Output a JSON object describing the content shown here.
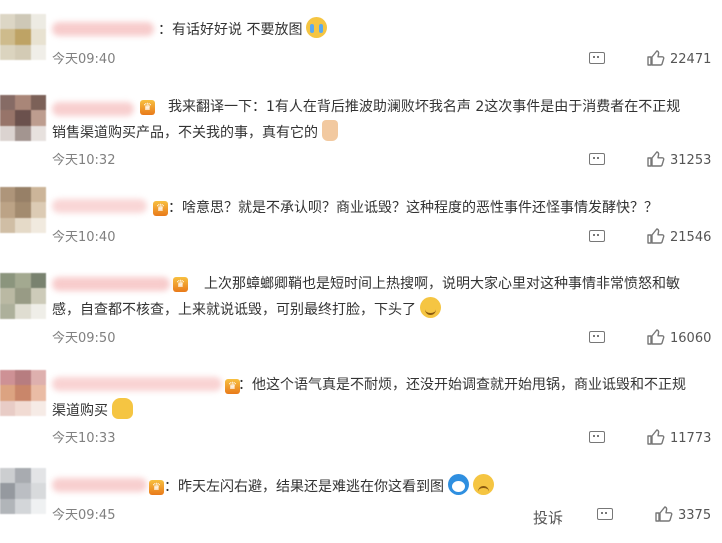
{
  "comments": [
    {
      "text": "：有话好好说 不要放图",
      "emoji": "cry-emoji",
      "time": "今天09:40",
      "likes": "22471",
      "avatar_colors": [
        "#d9d2bf",
        "#c9c3b0",
        "#ece9e0",
        "#c9b480",
        "#b89a55",
        "#e6dfcd",
        "#d8d0b9",
        "#cfc6ae",
        "#efede6"
      ]
    },
    {
      "text": "我来翻译一下：1有人在背后推波助澜败坏我名声 2这次事件是由于消费者在不正规销售渠道购买产品，不关我的事，真有它的",
      "emoji": "thumbs-up-emoji",
      "time": "今天10:32",
      "likes": "31253",
      "avatar_colors": [
        "#7a5c55",
        "#a07a6a",
        "#6e5046",
        "#8c6659",
        "#5c3f3a",
        "#b69383",
        "#d8cfcb",
        "#9a8a85",
        "#e5dedb"
      ]
    },
    {
      "text": "：啥意思？就是不承认呗？商业诋毁？这种程度的恶性事件还怪事情发酵快？？",
      "emoji": "",
      "time": "今天10:40",
      "likes": "21546",
      "avatar_colors": [
        "#a68a6c",
        "#8c7357",
        "#c7ae8e",
        "#b59a79",
        "#9a7f60",
        "#d9c6ac",
        "#cbb89c",
        "#e3d6c3",
        "#f0e8dc"
      ]
    },
    {
      "text": "上次那蟑螂卿鞘也是短时间上热搜啊，说明大家心里对这种事情非常愤怒和敏感，自查都不核查，上来就说诋毁，可别最终打脸，下头了",
      "emoji": "smile-emoji",
      "time": "今天09:50",
      "likes": "16060",
      "avatar_colors": [
        "#7f8a70",
        "#9aa085",
        "#6b7560",
        "#b3b29a",
        "#8d9178",
        "#c8c6b2",
        "#a5a891",
        "#dcdacd",
        "#eeede6"
      ]
    },
    {
      "text": "：他这个语气真是不耐烦，还没开始调查就开始甩锅，商业诋毁和不正规渠道购买",
      "emoji": "hug-emoji",
      "time": "今天10:33",
      "likes": "11773",
      "avatar_colors": [
        "#c9868a",
        "#b06f73",
        "#dba8a6",
        "#d99a74",
        "#c47a5a",
        "#e8b59c",
        "#e6c7c0",
        "#f0d8cf",
        "#f6e9e4"
      ]
    },
    {
      "text": "：昨天左闪右避，结果还是难逃在你这看到图",
      "emoji": "doraemon-emoji",
      "emoji2": "sad-emoji",
      "time": "今天09:45",
      "likes": "3375",
      "avatar_colors": [
        "#c7c9cc",
        "#9fa3a8",
        "#e0e2e4",
        "#8a8f95",
        "#b4b8bd",
        "#d4d6d9",
        "#a9adb2",
        "#cfd2d5",
        "#eef0f1"
      ]
    }
  ],
  "report_label": "投诉",
  "icons": {
    "reply": "comment-icon",
    "like": "thumbs-up-icon"
  },
  "colors": {
    "text": "#333333",
    "meta": "#808080",
    "badge": "#f0a030",
    "name_blur": "#f6c8c8"
  }
}
